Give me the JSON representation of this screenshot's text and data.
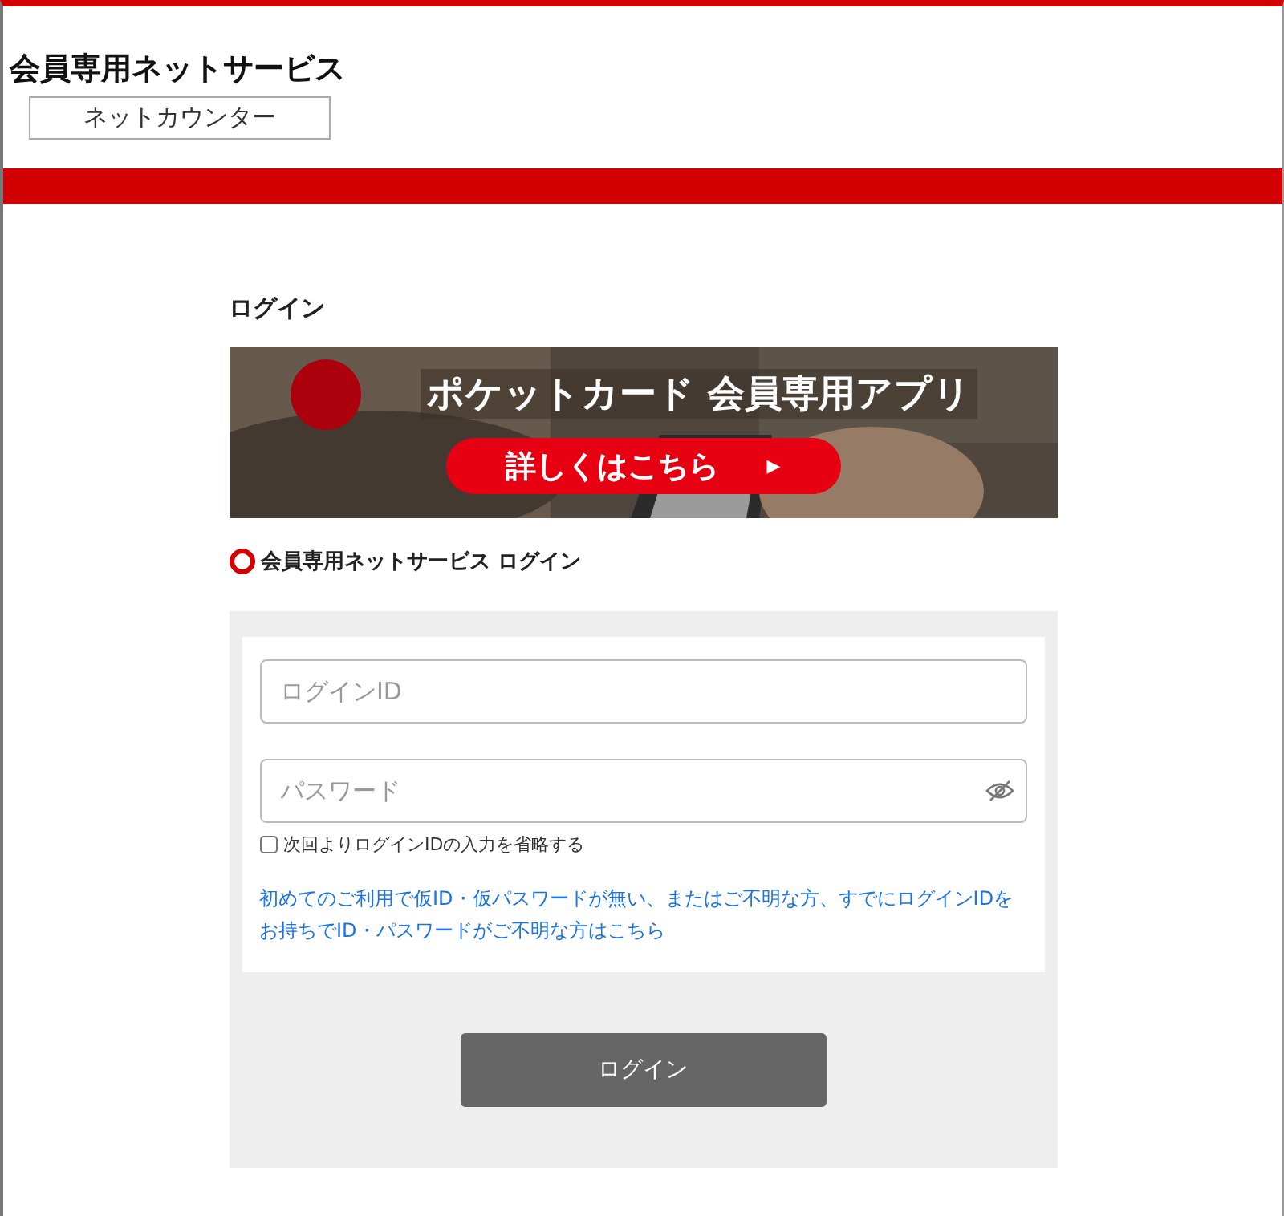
{
  "header": {
    "title": "会員専用ネットサービス",
    "counter_button": "ネットカウンター"
  },
  "page_title": "ログイン",
  "banner": {
    "headline": "ポケットカード 会員専用アプリ",
    "cta": "詳しくはこちら",
    "cta_arrow": "▶"
  },
  "section_heading": "会員専用ネットサービス ログイン",
  "form": {
    "login_id": {
      "placeholder": "ログインID"
    },
    "password": {
      "placeholder": "パスワード"
    },
    "remember": {
      "label": "次回よりログインIDの入力を省略する",
      "checked": false
    },
    "help_link": "初めてのご利用で仮ID・仮パスワードが無い、またはご不明な方、すでにログインIDをお持ちでID・パスワードがご不明な方はこちら",
    "submit": "ログイン"
  }
}
